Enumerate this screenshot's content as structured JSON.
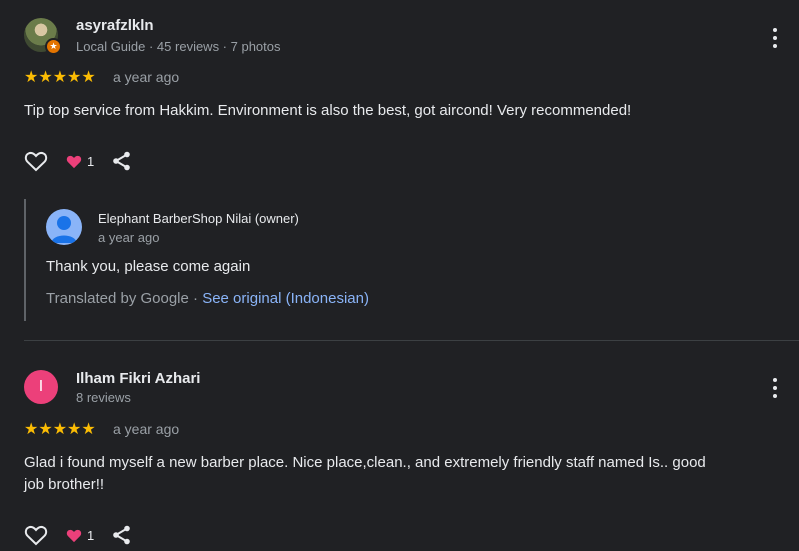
{
  "reviews": [
    {
      "name": "asyrafzlkln",
      "meta": "Local Guide · 45 reviews · 7 photos",
      "stars": "★★★★★",
      "date": "a year ago",
      "text": "Tip top service from Hakkim. Environment is also the best, got aircond! Very recommended!",
      "reaction_count": "1",
      "reply": {
        "owner": "Elephant BarberShop Nilai (owner)",
        "date": "a year ago",
        "text": "Thank you, please come again",
        "translated_by": "Translated by Google · ",
        "see_original": "See original (Indonesian)"
      }
    },
    {
      "name": "Ilham Fikri Azhari",
      "avatar_letter": "I",
      "meta": "8 reviews",
      "stars": "★★★★★",
      "date": "a year ago",
      "text_line1": "Glad i found myself a new barber place. Nice place,clean., and extremely friendly staff named Is.. good",
      "text_line2": "job brother!!",
      "reaction_count": "1"
    }
  ],
  "colors": {
    "star": "#fbbc04",
    "heart": "#ec407a",
    "link": "#8ab4f8",
    "background": "#202124"
  }
}
